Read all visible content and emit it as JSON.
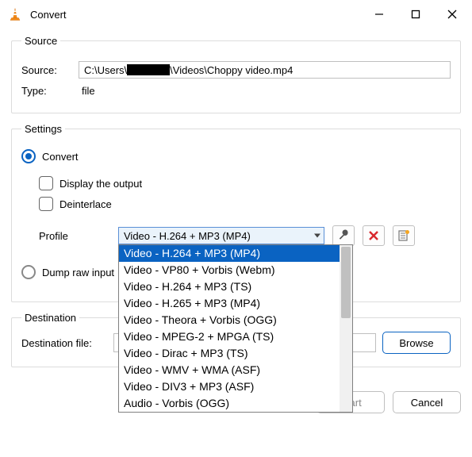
{
  "window": {
    "title": "Convert"
  },
  "source_group": {
    "legend": "Source",
    "source_label": "Source:",
    "source_path_prefix": "C:\\Users\\",
    "source_path_suffix": "\\Videos\\Choppy video.mp4",
    "type_label": "Type:",
    "type_value": "file"
  },
  "settings_group": {
    "legend": "Settings",
    "convert_label": "Convert",
    "display_output_label": "Display the output",
    "deinterlace_label": "Deinterlace",
    "profile_label": "Profile",
    "profile_selected": "Video - H.264 + MP3 (MP4)",
    "profile_options": [
      "Video - H.264 + MP3 (MP4)",
      "Video - VP80 + Vorbis (Webm)",
      "Video - H.264 + MP3 (TS)",
      "Video - H.265 + MP3 (MP4)",
      "Video - Theora + Vorbis (OGG)",
      "Video - MPEG-2 + MPGA (TS)",
      "Video - Dirac + MP3 (TS)",
      "Video - WMV + WMA (ASF)",
      "Video - DIV3 + MP3 (ASF)",
      "Audio - Vorbis (OGG)"
    ],
    "dump_raw_label": "Dump raw input"
  },
  "destination_group": {
    "legend": "Destination",
    "dest_label": "Destination file:",
    "browse_label": "Browse"
  },
  "footer": {
    "start_label": "Start",
    "cancel_label": "Cancel"
  }
}
